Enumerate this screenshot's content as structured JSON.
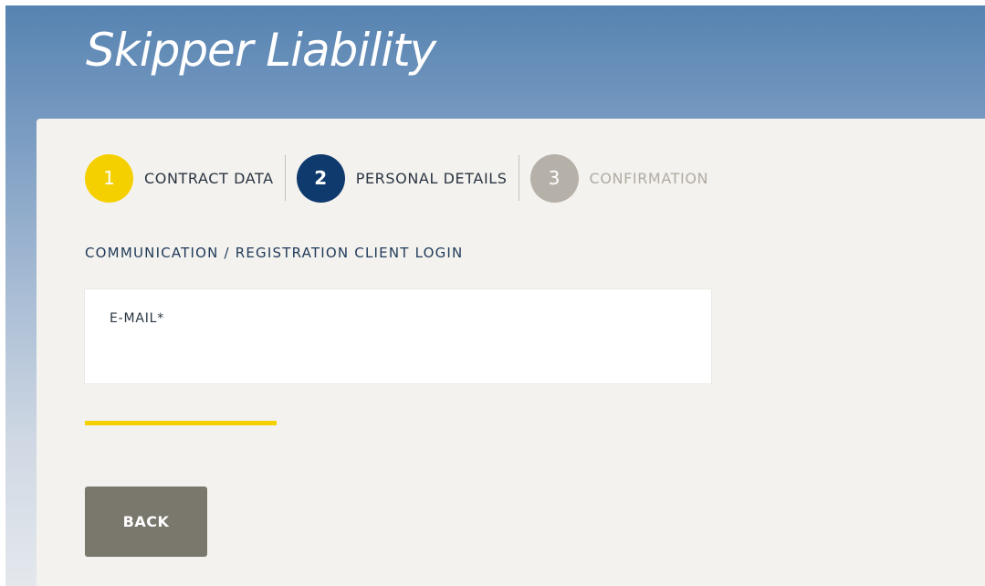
{
  "app": {
    "title": "Skipper Liability"
  },
  "steps": [
    {
      "number": "1",
      "label": "CONTRACT DATA",
      "state": "completed"
    },
    {
      "number": "2",
      "label": "PERSONAL DETAILS",
      "state": "active"
    },
    {
      "number": "3",
      "label": "CONFIRMATION",
      "state": "upcoming"
    }
  ],
  "section": {
    "title": "COMMUNICATION / REGISTRATION CLIENT LOGIN"
  },
  "email": {
    "label": "E-MAIL*",
    "value": "",
    "placeholder": ""
  },
  "actions": {
    "back_label": "BACK"
  },
  "colors": {
    "accent_yellow": "#f5d000",
    "active_navy": "#0f3a6e",
    "inactive_gray": "#b6b1a8",
    "button_gray": "#7a776c",
    "card_background": "#f4f2ee"
  }
}
